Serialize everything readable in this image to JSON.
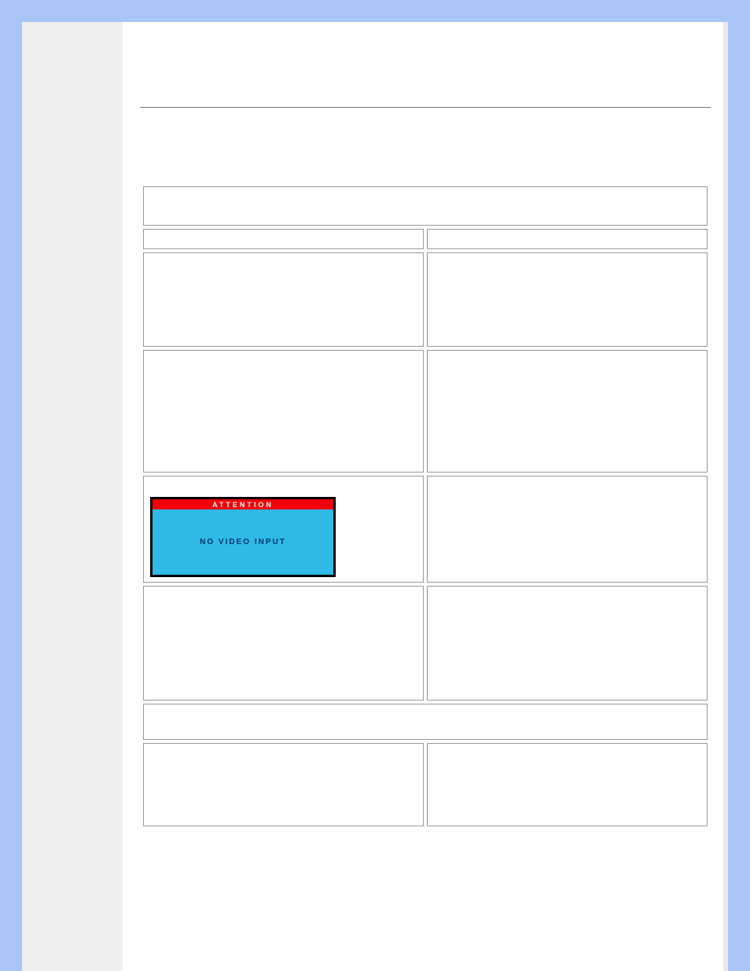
{
  "warning_box": {
    "title": "ATTENTION",
    "message": "NO VIDEO INPUT"
  }
}
